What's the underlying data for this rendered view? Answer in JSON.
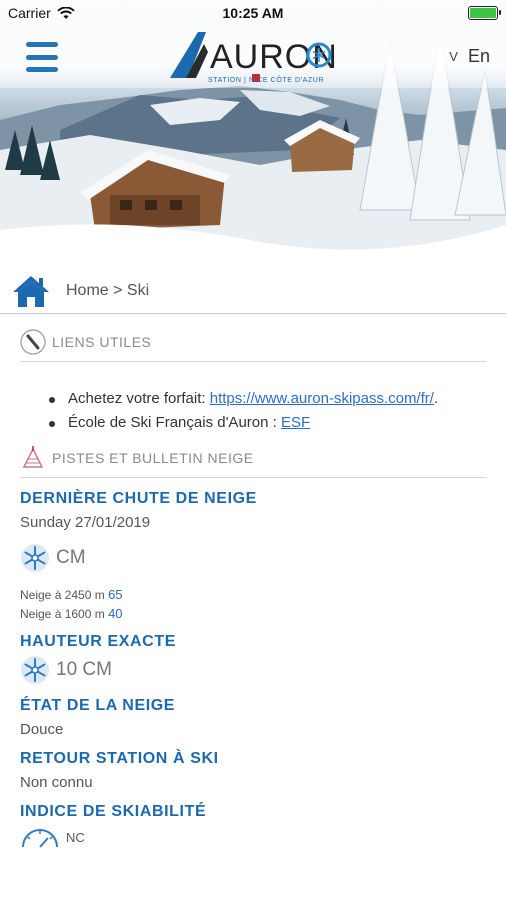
{
  "status_bar": {
    "carrier": "Carrier",
    "time": "10:25 AM",
    "battery_level": 1.0
  },
  "header": {
    "logo_text": "AURON",
    "logo_subtitle": "STATION | NICE CÔTE D'AZUR",
    "language": "En",
    "language_chevron": "V"
  },
  "breadcrumb": {
    "text": "Home > Ski"
  },
  "useful_links": {
    "title": "LIENS UTILES",
    "items": [
      {
        "prefix": "Achetez votre forfait: ",
        "link_text": "https://www.auron-skipass.com/fr/",
        "suffix": "."
      },
      {
        "prefix": "École de Ski Français d'Auron : ",
        "link_text": "ESF",
        "suffix": ""
      }
    ]
  },
  "snow_report": {
    "title": "PISTES ET BULLETIN NEIGE",
    "last_snowfall": {
      "label": "DERNIÈRE CHUTE DE NEIGE",
      "date": "Sunday 27/01/2019",
      "amount": "CM",
      "lines": [
        {
          "label": "Neige à 2450 m",
          "value": "65"
        },
        {
          "label": "Neige à 1600 m",
          "value": "40"
        }
      ]
    },
    "exact_height": {
      "label": "HAUTEUR EXACTE",
      "value": "10 CM"
    },
    "snow_state": {
      "label": "ÉTAT DE LA NEIGE",
      "value": "Douce"
    },
    "return_to_station": {
      "label": "RETOUR STATION À SKI",
      "value": "Non connu"
    },
    "skiability": {
      "label": "INDICE DE SKIABILITÉ",
      "value": "NC"
    }
  },
  "colors": {
    "accent_blue": "#1d69b0",
    "link_blue": "#2a6ecb",
    "menu_blue": "#2574b8",
    "logo_red": "#d0262e"
  }
}
